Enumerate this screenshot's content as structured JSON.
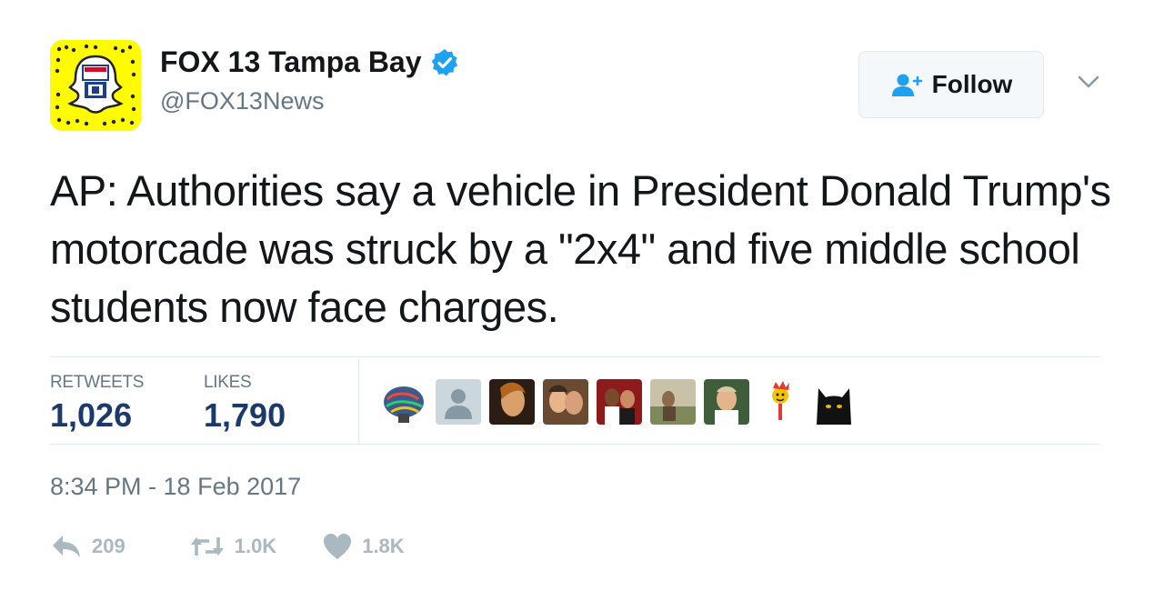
{
  "account": {
    "name": "FOX 13 Tampa Bay",
    "handle": "@FOX13News",
    "follow_label": "Follow"
  },
  "tweet": {
    "text": "AP: Authorities say a vehicle in President Donald Trump's motorcade was struck by a \"2x4\" and five middle school students now face charges.",
    "timestamp": "8:34 PM - 18 Feb 2017"
  },
  "stats": {
    "retweets_label": "RETWEETS",
    "retweets_value": "1,026",
    "likes_label": "LIKES",
    "likes_value": "1,790"
  },
  "actions": {
    "reply_count": "209",
    "retweet_count": "1.0K",
    "like_count": "1.8K"
  },
  "colors": {
    "verified": "#1da1f2",
    "follow_icon": "#1da1f2",
    "stats_value": "#1b3a6b",
    "muted": "#657786",
    "action_icon": "#aab8c2",
    "snapcode_yellow": "#fffc00"
  },
  "icons": {
    "verified": "verified-badge-icon",
    "follow": "add-user-icon",
    "menu": "chevron-down-icon",
    "reply": "reply-icon",
    "retweet": "retweet-icon",
    "like": "heart-icon"
  }
}
